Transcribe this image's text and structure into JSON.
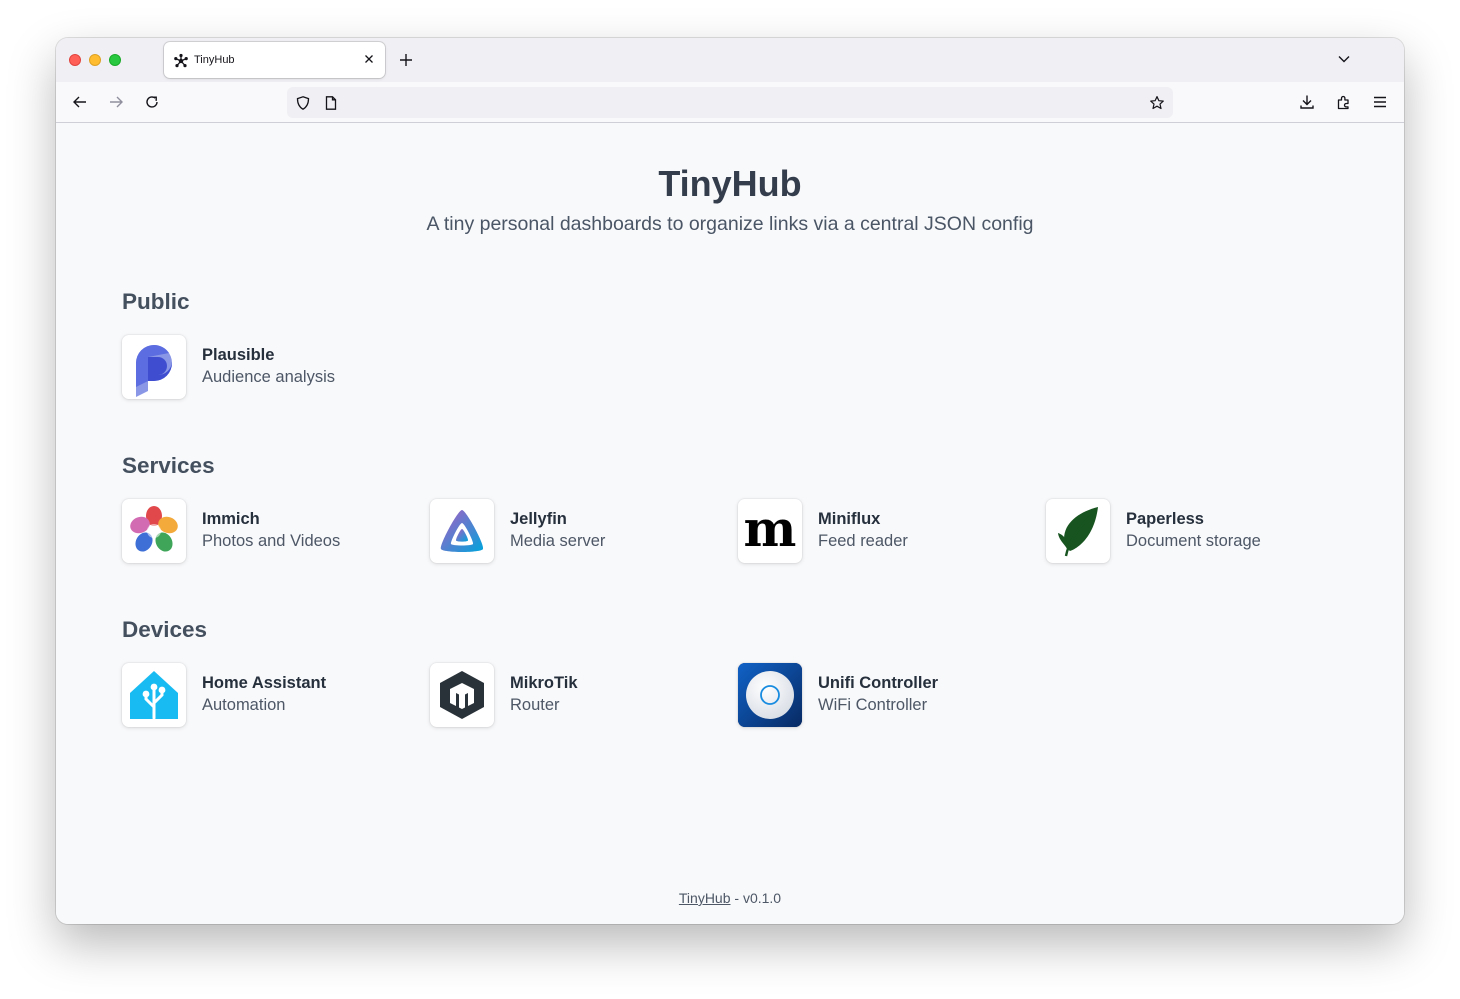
{
  "browser": {
    "tab_title": "TinyHub",
    "tab_favicon": "asterisk-icon",
    "url": "",
    "colors": {
      "close": "#ff5f57",
      "minimize": "#febc2e",
      "zoom": "#28c840"
    }
  },
  "header": {
    "title": "TinyHub",
    "subtitle": "A tiny personal dashboards to organize links via a central JSON config"
  },
  "sections": [
    {
      "title": "Public",
      "apps": [
        {
          "name": "Plausible",
          "description": "Audience analysis",
          "icon": "plausible-logo"
        }
      ]
    },
    {
      "title": "Services",
      "apps": [
        {
          "name": "Immich",
          "description": "Photos and Videos",
          "icon": "immich-logo"
        },
        {
          "name": "Jellyfin",
          "description": "Media server",
          "icon": "jellyfin-logo"
        },
        {
          "name": "Miniflux",
          "description": "Feed reader",
          "icon": "miniflux-logo"
        },
        {
          "name": "Paperless",
          "description": "Document storage",
          "icon": "paperless-logo"
        }
      ]
    },
    {
      "title": "Devices",
      "apps": [
        {
          "name": "Home Assistant",
          "description": "Automation",
          "icon": "home-assistant-logo"
        },
        {
          "name": "MikroTik",
          "description": "Router",
          "icon": "mikrotik-logo"
        },
        {
          "name": "Unifi Controller",
          "description": "WiFi Controller",
          "icon": "unifi-logo"
        }
      ]
    }
  ],
  "footer": {
    "link_text": "TinyHub",
    "version": " - v0.1.0"
  }
}
